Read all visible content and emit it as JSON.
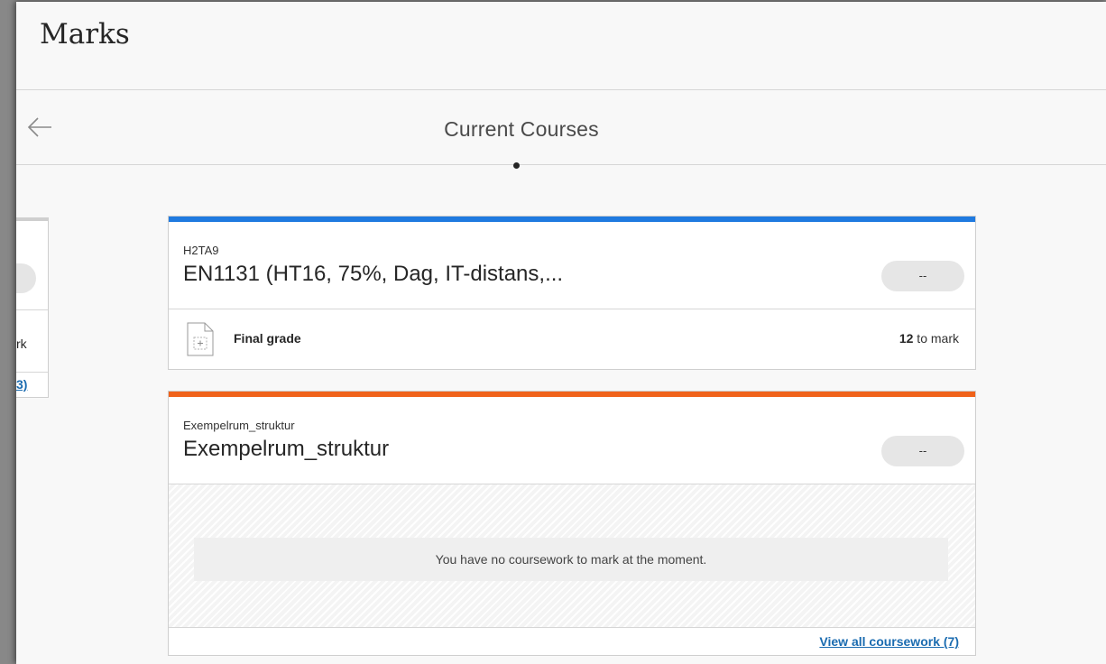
{
  "page": {
    "title": "Marks"
  },
  "nav": {
    "back_icon": "arrow-left-icon",
    "section_title": "Current Courses"
  },
  "peek_card": {
    "text": "rk",
    "link": "3)"
  },
  "courses": [
    {
      "code": "H2TA9",
      "name": "EN1131 (HT16, 75%, Dag, IT-distans,...",
      "grade": "--",
      "accent": "#1f7ae0",
      "items": [
        {
          "icon": "document-icon",
          "label": "Final grade",
          "count": "12",
          "count_suffix": " to mark"
        }
      ]
    },
    {
      "code": "Exempelrum_struktur",
      "name": "Exempelrum_struktur",
      "grade": "--",
      "accent": "#f0621a",
      "empty_message": "You have no coursework to mark at the moment.",
      "footer_link": "View all coursework (7)"
    }
  ]
}
